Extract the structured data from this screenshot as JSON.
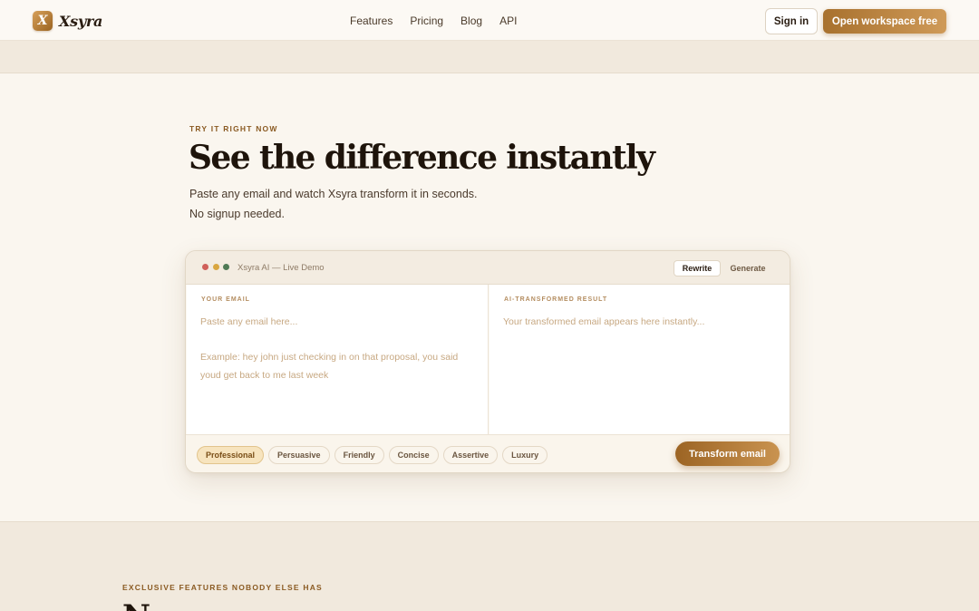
{
  "nav": {
    "brand_logo_letter": "X",
    "brand_name": "Xsyra",
    "links": [
      "Features",
      "Pricing",
      "Blog",
      "API"
    ],
    "signin_label": "Sign in",
    "cta_label": "Open workspace free"
  },
  "hero": {
    "eyebrow": "TRY IT RIGHT NOW",
    "title": "See the difference instantly",
    "subtitle_line1": "Paste any email and watch Xsyra transform it in seconds.",
    "subtitle_line2": "No signup needed."
  },
  "demo": {
    "window_title": "Xsyra AI — Live Demo",
    "modes": {
      "rewrite": "Rewrite",
      "generate": "Generate"
    },
    "active_mode": "Rewrite",
    "input": {
      "label": "YOUR EMAIL",
      "placeholder": "Paste any email here...\n\nExample: hey john just checking in on that proposal, you said youd get back to me last week"
    },
    "output": {
      "label": "AI-TRANSFORMED RESULT",
      "placeholder": "Your transformed email appears here instantly..."
    },
    "tones": [
      "Professional",
      "Persuasive",
      "Friendly",
      "Concise",
      "Assertive",
      "Luxury"
    ],
    "active_tone": "Professional",
    "transform_label": "Transform email"
  },
  "features": {
    "eyebrow": "EXCLUSIVE FEATURES NOBODY ELSE HAS",
    "title_partial": "N"
  },
  "colors": {
    "accent": "#a8712e",
    "accent_light": "#cf9a58",
    "background": "#faf6ef",
    "band": "#f1e9dd"
  }
}
